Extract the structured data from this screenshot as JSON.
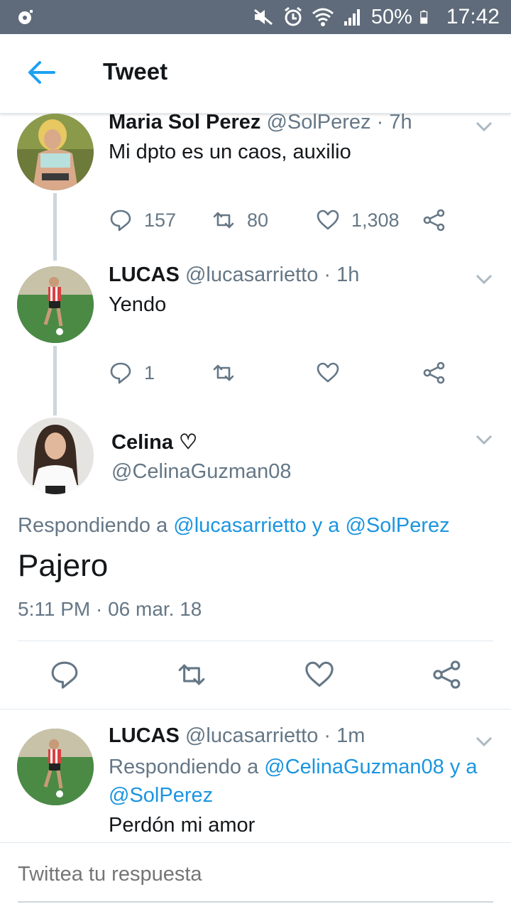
{
  "status_bar": {
    "battery_percent": "50%",
    "time": "17:42"
  },
  "header": {
    "title": "Tweet"
  },
  "tweets": [
    {
      "name": "Maria Sol Perez",
      "handle": "@SolPerez",
      "time": "· 7h",
      "text": "Mi dpto es un caos, auxilio",
      "replies": "157",
      "retweets": "80",
      "likes": "1,308"
    },
    {
      "name": "LUCAS",
      "handle": "@lucasarrietto",
      "time": "· 1h",
      "text": "Yendo",
      "replies": "1",
      "retweets": "",
      "likes": ""
    }
  ],
  "main_tweet": {
    "name": "Celina ♡",
    "handle": "@CelinaGuzman08",
    "reply_prefix": "Respondiendo a",
    "reply_targets": "@lucasarrietto y a @SolPerez",
    "text": "Pajero",
    "date": "5:11 PM · 06 mar. 18"
  },
  "reply_tweet": {
    "name": "LUCAS",
    "handle": "@lucasarrietto",
    "time": "· 1m",
    "reply_prefix": "Respondiendo a",
    "reply_line1": "@CelinaGuzman08 y a",
    "reply_line2": "@SolPerez",
    "text": "Perdón mi amor"
  },
  "reply_bar": {
    "placeholder": "Twittea tu respuesta"
  },
  "colors": {
    "accent": "#1da1f2",
    "link": "#1b95e0",
    "secondary_text": "#657786",
    "status_bar": "#5f6b7a"
  }
}
